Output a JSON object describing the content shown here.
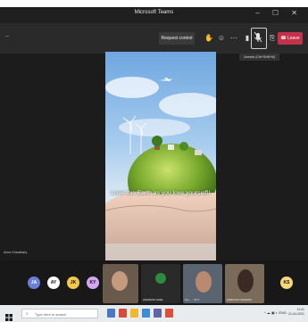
{
  "window": {
    "title": "Microsoft Teams",
    "controls": "–  ☐  ✕"
  },
  "toolbar": {
    "timer": "-- ",
    "request_control": "Request control",
    "leave": "Leave",
    "unmute_tooltip": "Unmute (Ctrl+Shift+M)"
  },
  "slide": {
    "caption": "Love this Earth as you love yourself!!"
  },
  "presenter": {
    "name": "Anna Chaudhary"
  },
  "participants": {
    "avatars": [
      "JA",
      "AY",
      "JK",
      "KY"
    ],
    "tiles": [
      {
        "label": ""
      },
      {
        "label": "ASHWANI GOEL"
      },
      {
        "label": "GA... ...TA T."
      },
      {
        "label": "SHREYAN SHARMA"
      }
    ],
    "end_avatar": "KS"
  },
  "taskbar": {
    "search_placeholder": "Type here to search",
    "tray": "^  ☁  ▣  ◐  ENG",
    "time": "11:41",
    "date": "21-04-2021"
  },
  "colors": {
    "leave_red": "#c4314b",
    "toolbar": "#2a2a2a",
    "stage": "#1c1c1c"
  }
}
